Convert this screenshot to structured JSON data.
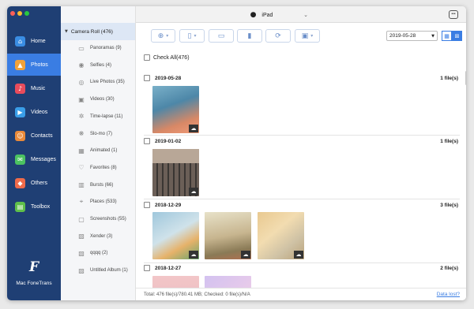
{
  "device": {
    "name": "iPad",
    "icon": "apple-icon"
  },
  "nav": [
    {
      "label": "Home",
      "icon": "home-icon",
      "glyph": "⌂",
      "color": "#3a8de3"
    },
    {
      "label": "Photos",
      "icon": "photos-icon",
      "glyph": "▲",
      "color": "#f2a23a",
      "active": true
    },
    {
      "label": "Music",
      "icon": "music-icon",
      "glyph": "♪",
      "color": "#e84c5c"
    },
    {
      "label": "Videos",
      "icon": "videos-icon",
      "glyph": "▶",
      "color": "#3a9ee8"
    },
    {
      "label": "Contacts",
      "icon": "contacts-icon",
      "glyph": "☺",
      "color": "#e98a3a"
    },
    {
      "label": "Messages",
      "icon": "messages-icon",
      "glyph": "✉",
      "color": "#4cc261"
    },
    {
      "label": "Others",
      "icon": "others-icon",
      "glyph": "◆",
      "color": "#ef6b4a"
    },
    {
      "label": "Toolbox",
      "icon": "toolbox-icon",
      "glyph": "▤",
      "color": "#5fbf4a"
    }
  ],
  "logo": {
    "text": "Mac FoneTrans"
  },
  "albums": {
    "header": "Camera Roll (476)",
    "items": [
      {
        "label": "Panoramas (9)",
        "glyph": "▭",
        "icon": "panorama-icon"
      },
      {
        "label": "Selfies (4)",
        "glyph": "◉",
        "icon": "selfie-icon"
      },
      {
        "label": "Live Photos (35)",
        "glyph": "◎",
        "icon": "live-photo-icon"
      },
      {
        "label": "Videos (30)",
        "glyph": "▣",
        "icon": "video-icon"
      },
      {
        "label": "Time-lapse (11)",
        "glyph": "✲",
        "icon": "time-lapse-icon"
      },
      {
        "label": "Slo-mo (7)",
        "glyph": "❋",
        "icon": "slo-mo-icon"
      },
      {
        "label": "Animated (1)",
        "glyph": "▦",
        "icon": "animated-icon"
      },
      {
        "label": "Favorites (8)",
        "glyph": "♡",
        "icon": "heart-icon"
      },
      {
        "label": "Bursts (66)",
        "glyph": "▥",
        "icon": "bursts-icon"
      },
      {
        "label": "Places (533)",
        "glyph": "⌖",
        "icon": "places-icon"
      },
      {
        "label": "Screenshots (55)",
        "glyph": "▢",
        "icon": "screenshot-icon"
      },
      {
        "label": "Xender (3)",
        "glyph": "▧",
        "icon": "album-icon"
      },
      {
        "label": "qqqq (2)",
        "glyph": "▧",
        "icon": "album-icon"
      },
      {
        "label": "Untitled Album (1)",
        "glyph": "▧",
        "icon": "album-icon"
      }
    ]
  },
  "toolbar": {
    "date": "2019-05-28",
    "accent": "#3a7de3"
  },
  "content": {
    "check_all": "Check All(476)",
    "groups": [
      {
        "date": "2019-05-28",
        "count": "1 file(s)"
      },
      {
        "date": "2019-01-02",
        "count": "1 file(s)"
      },
      {
        "date": "2018-12-29",
        "count": "3 file(s)"
      },
      {
        "date": "2018-12-27",
        "count": "2 file(s)"
      }
    ]
  },
  "status": {
    "text": "Total: 476 file(s)/780.41 MB; Checked: 0 file(s)/N/A",
    "link": "Data lost?"
  }
}
